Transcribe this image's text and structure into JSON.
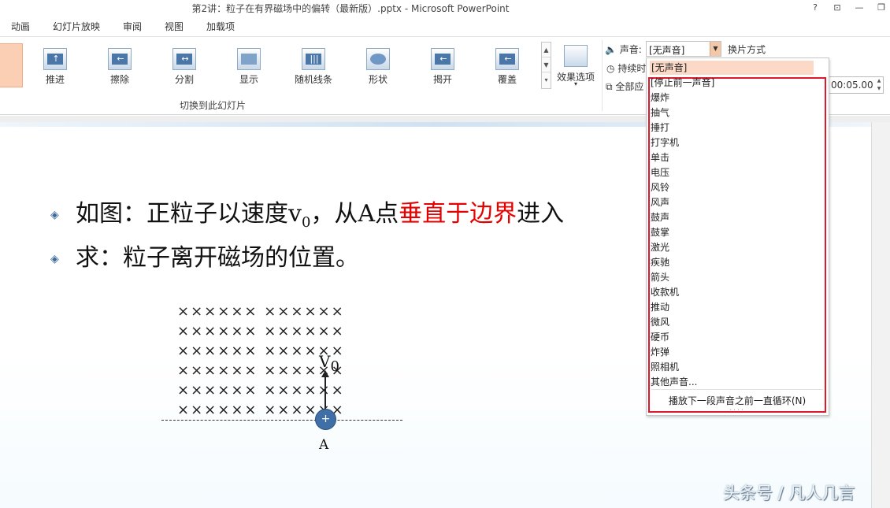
{
  "window": {
    "title": "第2讲：粒子在有界磁场中的偏转（最新版）.pptx - Microsoft PowerPoint",
    "help": "?"
  },
  "tabs": [
    "动画",
    "幻灯片放映",
    "审阅",
    "视图",
    "加载项"
  ],
  "ribbon": {
    "effects": [
      {
        "label": "推进",
        "icon": "push-icon",
        "glyph": "↑"
      },
      {
        "label": "擦除",
        "icon": "wipe-icon",
        "glyph": "←"
      },
      {
        "label": "分割",
        "icon": "split-icon",
        "glyph": "↔"
      },
      {
        "label": "显示",
        "icon": "reveal-icon",
        "glyph": ""
      },
      {
        "label": "随机线条",
        "icon": "random-bars-icon",
        "glyph": "|||"
      },
      {
        "label": "形状",
        "icon": "shape-icon",
        "glyph": "◎"
      },
      {
        "label": "揭开",
        "icon": "uncover-icon",
        "glyph": "←"
      },
      {
        "label": "覆盖",
        "icon": "cover-icon",
        "glyph": "←"
      }
    ],
    "group_label": "切换到此幻灯片",
    "effect_options": "效果选项",
    "sound_label": "声音:",
    "sound_value": "[无声音]",
    "advance_label": "换片方式",
    "duration_label": "持续时",
    "apply_all_label": "全部应",
    "time_value": "00:05.00"
  },
  "slide": {
    "line1_prefix": "如图：正粒子以速度v",
    "line1_sub": "0",
    "line1_mid": "，从A点",
    "line1_red": "垂直于边界",
    "line1_suffix": "进入",
    "line2": "求：粒子离开磁场的位置。",
    "field_rows": [
      "××××××  ××××××",
      "××××××  ××××××",
      "××××××  ××××××",
      "××××××  ××××××",
      "××××××  ××××××",
      "××××××  ××××××"
    ],
    "particle_sign": "+",
    "velocity_label": "V",
    "velocity_sub": "0",
    "point_label": "A"
  },
  "dropdown": {
    "selected": "[无声音]",
    "items": [
      "[停止前一声音]",
      "爆炸",
      "抽气",
      "捶打",
      "打字机",
      "单击",
      "电压",
      "风铃",
      "风声",
      "鼓声",
      "鼓掌",
      "激光",
      "疾驰",
      "箭头",
      "收款机",
      "推动",
      "微风",
      "硬币",
      "炸弹",
      "照相机",
      "其他声音..."
    ],
    "loop_label": "播放下一段声音之前一直循环(N)"
  },
  "watermark": "头条号 / 凡人几言"
}
